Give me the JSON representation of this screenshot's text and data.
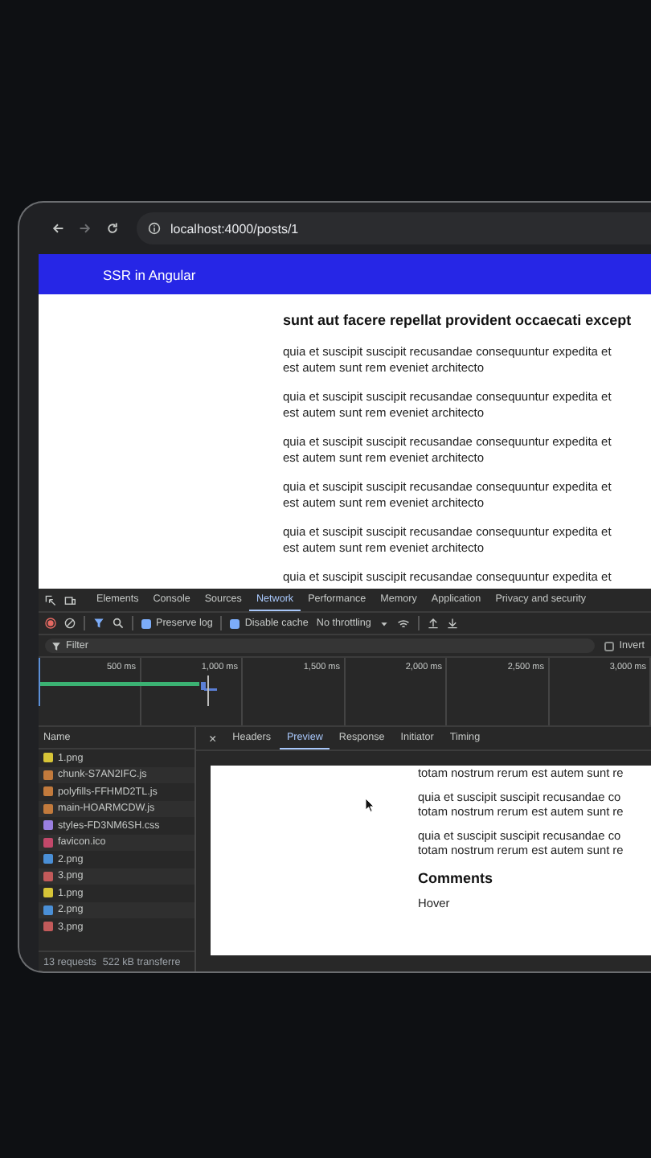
{
  "browser": {
    "url": "localhost:4000/posts/1"
  },
  "page": {
    "brand": "SSR in Angular",
    "title": "sunt aut facere repellat provident occaecati except",
    "paragraphs": [
      {
        "lines": [
          "quia et suscipit suscipit recusandae consequuntur expedita et",
          "est autem sunt rem eveniet architecto"
        ]
      },
      {
        "lines": [
          "quia et suscipit suscipit recusandae consequuntur expedita et",
          "est autem sunt rem eveniet architecto"
        ]
      },
      {
        "lines": [
          "quia et suscipit suscipit recusandae consequuntur expedita et",
          "est autem sunt rem eveniet architecto"
        ]
      },
      {
        "lines": [
          "quia et suscipit suscipit recusandae consequuntur expedita et",
          "est autem sunt rem eveniet architecto"
        ]
      },
      {
        "lines": [
          "quia et suscipit suscipit recusandae consequuntur expedita et",
          "est autem sunt rem eveniet architecto"
        ]
      },
      {
        "lines": [
          "quia et suscipit suscipit recusandae consequuntur expedita et"
        ]
      }
    ]
  },
  "devtools": {
    "tabs": [
      {
        "label": "Elements",
        "selected": false
      },
      {
        "label": "Console",
        "selected": false
      },
      {
        "label": "Sources",
        "selected": false
      },
      {
        "label": "Network",
        "selected": true
      },
      {
        "label": "Performance",
        "selected": false
      },
      {
        "label": "Memory",
        "selected": false
      },
      {
        "label": "Application",
        "selected": false
      },
      {
        "label": "Privacy and security",
        "selected": false
      }
    ],
    "toolbar": {
      "preserve_log": {
        "label": "Preserve log",
        "checked": true
      },
      "disable_cache": {
        "label": "Disable cache",
        "checked": true
      },
      "throttling": "No throttling"
    },
    "filter": {
      "placeholder": "Filter",
      "invert": {
        "label": "Invert",
        "checked": false
      }
    },
    "timeline": {
      "ticks": [
        "500 ms",
        "1,000 ms",
        "1,500 ms",
        "2,000 ms",
        "2,500 ms",
        "3,000 ms"
      ]
    },
    "requests": {
      "header": "Name",
      "rows": [
        {
          "name": "1.png",
          "color": "#d6c437"
        },
        {
          "name": "chunk-S7AN2IFC.js",
          "color": "#c27a3c"
        },
        {
          "name": "polyfills-FFHMD2TL.js",
          "color": "#c27a3c"
        },
        {
          "name": "main-HOARMCDW.js",
          "color": "#c27a3c"
        },
        {
          "name": "styles-FD3NM6SH.css",
          "color": "#9a7fe0"
        },
        {
          "name": "favicon.ico",
          "color": "#c2486a"
        },
        {
          "name": "2.png",
          "color": "#4a8fd6"
        },
        {
          "name": "3.png",
          "color": "#c25a5a"
        },
        {
          "name": "1.png",
          "color": "#d6c437"
        },
        {
          "name": "2.png",
          "color": "#4a8fd6"
        },
        {
          "name": "3.png",
          "color": "#c25a5a"
        }
      ]
    },
    "status": [
      "13 requests",
      "522 kB transferre"
    ],
    "detail": {
      "close": "×",
      "tabs": [
        {
          "label": "Headers",
          "selected": false
        },
        {
          "label": "Preview",
          "selected": true
        },
        {
          "label": "Response",
          "selected": false
        },
        {
          "label": "Initiator",
          "selected": false
        },
        {
          "label": "Timing",
          "selected": false
        }
      ],
      "preview": [
        {
          "kind": "text",
          "lines": [
            "totam nostrum rerum est autem sunt re"
          ]
        },
        {
          "kind": "text",
          "lines": [
            "quia et suscipit suscipit recusandae co",
            "totam nostrum rerum est autem sunt re"
          ]
        },
        {
          "kind": "text",
          "lines": [
            "quia et suscipit suscipit recusandae co",
            "totam nostrum rerum est autem sunt re"
          ]
        },
        {
          "kind": "heading",
          "lines": [
            "Comments"
          ]
        },
        {
          "kind": "text",
          "lines": [
            "Hover"
          ]
        }
      ]
    }
  }
}
